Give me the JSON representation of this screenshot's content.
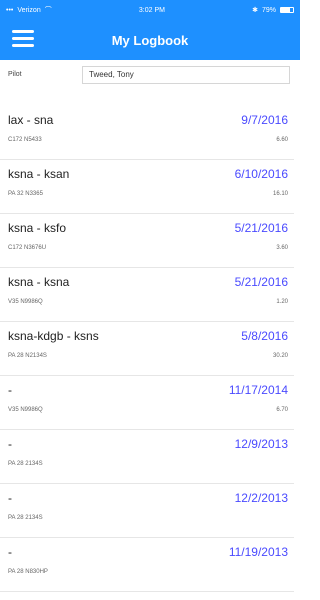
{
  "status_bar": {
    "carrier": "Verizon",
    "time": "3:02 PM",
    "battery": "79%",
    "battery_level": 0.79
  },
  "header": {
    "title": "My Logbook",
    "menu_icon": "hamburger-menu-icon"
  },
  "filter": {
    "label": "Pilot",
    "value": "Tweed, Tony"
  },
  "entries": [
    {
      "route": "lax - sna",
      "date": "9/7/2016",
      "aircraft": "C172 N5433",
      "hours": "6.60"
    },
    {
      "route": "ksna - ksan",
      "date": "6/10/2016",
      "aircraft": "PA 32 N3365",
      "hours": "16.10"
    },
    {
      "route": "ksna - ksfo",
      "date": "5/21/2016",
      "aircraft": "C172 N3676U",
      "hours": "3.60"
    },
    {
      "route": "ksna - ksna",
      "date": "5/21/2016",
      "aircraft": "V35 N9986Q",
      "hours": "1.20"
    },
    {
      "route": "ksna-kdgb - ksns",
      "date": "5/8/2016",
      "aircraft": "PA 28 N2134S",
      "hours": "30.20"
    },
    {
      "route": "-",
      "date": "11/17/2014",
      "aircraft": "V35 N9986Q",
      "hours": "6.70"
    },
    {
      "route": "-",
      "date": "12/9/2013",
      "aircraft": "PA 28 2134S",
      "hours": ""
    },
    {
      "route": "-",
      "date": "12/2/2013",
      "aircraft": "PA 28 2134S",
      "hours": ""
    },
    {
      "route": "-",
      "date": "11/19/2013",
      "aircraft": "PA 28 N830HP",
      "hours": ""
    }
  ],
  "colors": {
    "primary": "#1e90ff",
    "date": "#4a4aff",
    "divider": "#e6e6e6"
  }
}
